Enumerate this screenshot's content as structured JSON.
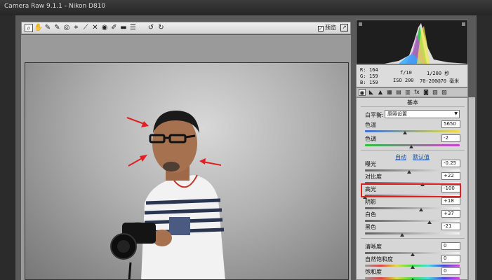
{
  "window": {
    "title": "Camera Raw 9.1.1  -  Nikon D810"
  },
  "toolbar": {
    "tools": [
      {
        "name": "zoom-tool",
        "icon": "magnifier-icon",
        "glyph": "⌕"
      },
      {
        "name": "hand-tool",
        "icon": "hand-icon",
        "glyph": "✋"
      },
      {
        "name": "white-balance-tool",
        "icon": "eyedropper-icon",
        "glyph": "✎"
      },
      {
        "name": "color-sampler-tool",
        "icon": "color-sampler-icon",
        "glyph": "✎"
      },
      {
        "name": "targeted-adjustment-tool",
        "icon": "target-adjust-icon",
        "glyph": "◎"
      },
      {
        "name": "crop-tool",
        "icon": "crop-icon",
        "glyph": "⌗"
      },
      {
        "name": "straighten-tool",
        "icon": "straighten-icon",
        "glyph": "⟋"
      },
      {
        "name": "spot-removal-tool",
        "icon": "spot-removal-icon",
        "glyph": "✕"
      },
      {
        "name": "red-eye-tool",
        "icon": "red-eye-icon",
        "glyph": "◉"
      },
      {
        "name": "adjustment-brush-tool",
        "icon": "brush-icon",
        "glyph": "✐"
      },
      {
        "name": "graduated-filter-tool",
        "icon": "graduated-filter-icon",
        "glyph": "▬"
      },
      {
        "name": "preferences-tool",
        "icon": "list-icon",
        "glyph": "☰"
      },
      {
        "name": "rotate-left-tool",
        "icon": "rotate-ccw-icon",
        "glyph": "↺"
      },
      {
        "name": "rotate-right-tool",
        "icon": "rotate-cw-icon",
        "glyph": "↻"
      }
    ],
    "preview_label": "预览",
    "preview_checked": "✓",
    "fullscreen_icon": "↗"
  },
  "info": {
    "r_label": "R:",
    "r_value": "164",
    "g_label": "G:",
    "g_value": "159",
    "b_label": "B:",
    "b_value": "159",
    "aperture": "f/10",
    "shutter": "1/200 秒",
    "iso": "ISO 200",
    "lens": "70-200@70 毫米"
  },
  "panel_tabs": [
    {
      "name": "basic-tab",
      "glyph": "◉",
      "active": true
    },
    {
      "name": "tone-curve-tab",
      "glyph": "◣"
    },
    {
      "name": "detail-tab",
      "glyph": "▲"
    },
    {
      "name": "hsl-tab",
      "glyph": "▦"
    },
    {
      "name": "split-toning-tab",
      "glyph": "▤"
    },
    {
      "name": "lens-corrections-tab",
      "glyph": "▥"
    },
    {
      "name": "effects-tab",
      "glyph": "fx"
    },
    {
      "name": "camera-calibration-tab",
      "glyph": "◙"
    },
    {
      "name": "presets-tab",
      "glyph": "▧"
    },
    {
      "name": "snapshots-tab",
      "glyph": "▨"
    }
  ],
  "basic": {
    "title": "基本",
    "wb_label": "白平衡:",
    "wb_value": "原照设置",
    "auto_label": "自动",
    "default_label": "默认值",
    "rows": [
      {
        "name": "temperature",
        "label": "色温",
        "value": "5650",
        "pos": 0.42,
        "track": "temp"
      },
      {
        "name": "tint",
        "label": "色调",
        "value": "-2",
        "pos": 0.49,
        "track": "tint"
      },
      {
        "name": "exposure",
        "label": "曝光",
        "value": "-0.25",
        "pos": 0.47,
        "track": "gray"
      },
      {
        "name": "contrast",
        "label": "对比度",
        "value": "+22",
        "pos": 0.61,
        "track": "gray"
      },
      {
        "name": "highlights",
        "label": "高光",
        "value": "-100",
        "pos": 0.0,
        "track": "gray"
      },
      {
        "name": "shadows",
        "label": "阴影",
        "value": "+18",
        "pos": 0.59,
        "track": "gray"
      },
      {
        "name": "whites",
        "label": "白色",
        "value": "+37",
        "pos": 0.68,
        "track": "gray"
      },
      {
        "name": "blacks",
        "label": "黑色",
        "value": "-21",
        "pos": 0.39,
        "track": "gray"
      },
      {
        "name": "clarity",
        "label": "清晰度",
        "value": "0",
        "pos": 0.5,
        "track": "gray"
      },
      {
        "name": "vibrance",
        "label": "自然饱和度",
        "value": "0",
        "pos": 0.5,
        "track": "sat"
      },
      {
        "name": "saturation",
        "label": "饱和度",
        "value": "0",
        "pos": 0.5,
        "track": "sat"
      }
    ]
  },
  "colors": {
    "highlight_box": "#e02020",
    "arrow": "#e02020",
    "link": "#1a4fb0"
  }
}
